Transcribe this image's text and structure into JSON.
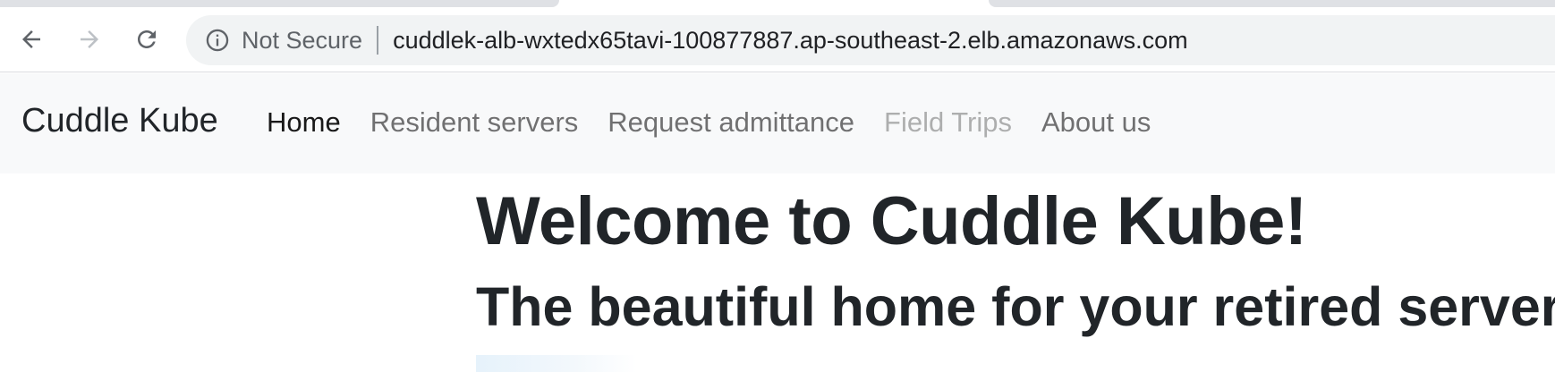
{
  "browser": {
    "security_label": "Not Secure",
    "url": "cuddlek-alb-wxtedx65tavi-100877887.ap-southeast-2.elb.amazonaws.com",
    "icons": {
      "back": "arrow-left-icon",
      "forward": "arrow-right-icon",
      "reload": "reload-icon",
      "info": "info-circle-icon"
    }
  },
  "navbar": {
    "brand": "Cuddle Kube",
    "links": [
      {
        "label": "Home",
        "state": "active"
      },
      {
        "label": "Resident servers",
        "state": "normal"
      },
      {
        "label": "Request admittance",
        "state": "normal"
      },
      {
        "label": "Field Trips",
        "state": "disabled"
      },
      {
        "label": "About us",
        "state": "normal"
      }
    ]
  },
  "main": {
    "title": "Welcome to Cuddle Kube!",
    "subtitle": "The beautiful home for your retired servers"
  },
  "colors": {
    "navbar_bg": "#f8f9fa",
    "text": "#212529",
    "omnibox_bg": "#f1f3f4"
  }
}
